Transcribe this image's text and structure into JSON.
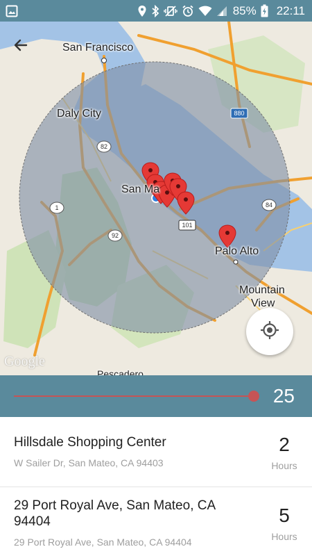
{
  "status_bar": {
    "battery_percent": "85%",
    "time": "22:11",
    "icons": [
      "image-icon",
      "location-icon",
      "bluetooth-icon",
      "vibrate-icon",
      "alarm-icon",
      "wifi-icon",
      "signal-icon",
      "battery-charging-icon"
    ]
  },
  "map": {
    "labels": {
      "san_francisco": "San Francisco",
      "daly_city": "Daly City",
      "san_mateo": "San Ma",
      "palo_alto": "Palo Alto",
      "mountain_view_1": "Mountain",
      "mountain_view_2": "View",
      "pescadero": "Pescadero"
    },
    "highway_shields": [
      "880",
      "82",
      "1",
      "84",
      "92",
      "101"
    ],
    "attribution": "Google",
    "radius_circle_color": "#7f8fa6"
  },
  "slider": {
    "value": "25",
    "fraction": 1.0,
    "accent_color": "#c65456"
  },
  "list": {
    "items": [
      {
        "title": "Hillsdale Shopping Center",
        "address": "W Sailer Dr, San Mateo, CA 94403",
        "count": "2",
        "unit": "Hours"
      },
      {
        "title": "29 Port Royal Ave, San Mateo, CA 94404",
        "address": "29 Port Royal Ave, San Mateo, CA 94404",
        "count": "5",
        "unit": "Hours"
      }
    ]
  },
  "colors": {
    "primary": "#5a8a9c",
    "accent": "#c65456",
    "pin": "#e53935"
  }
}
